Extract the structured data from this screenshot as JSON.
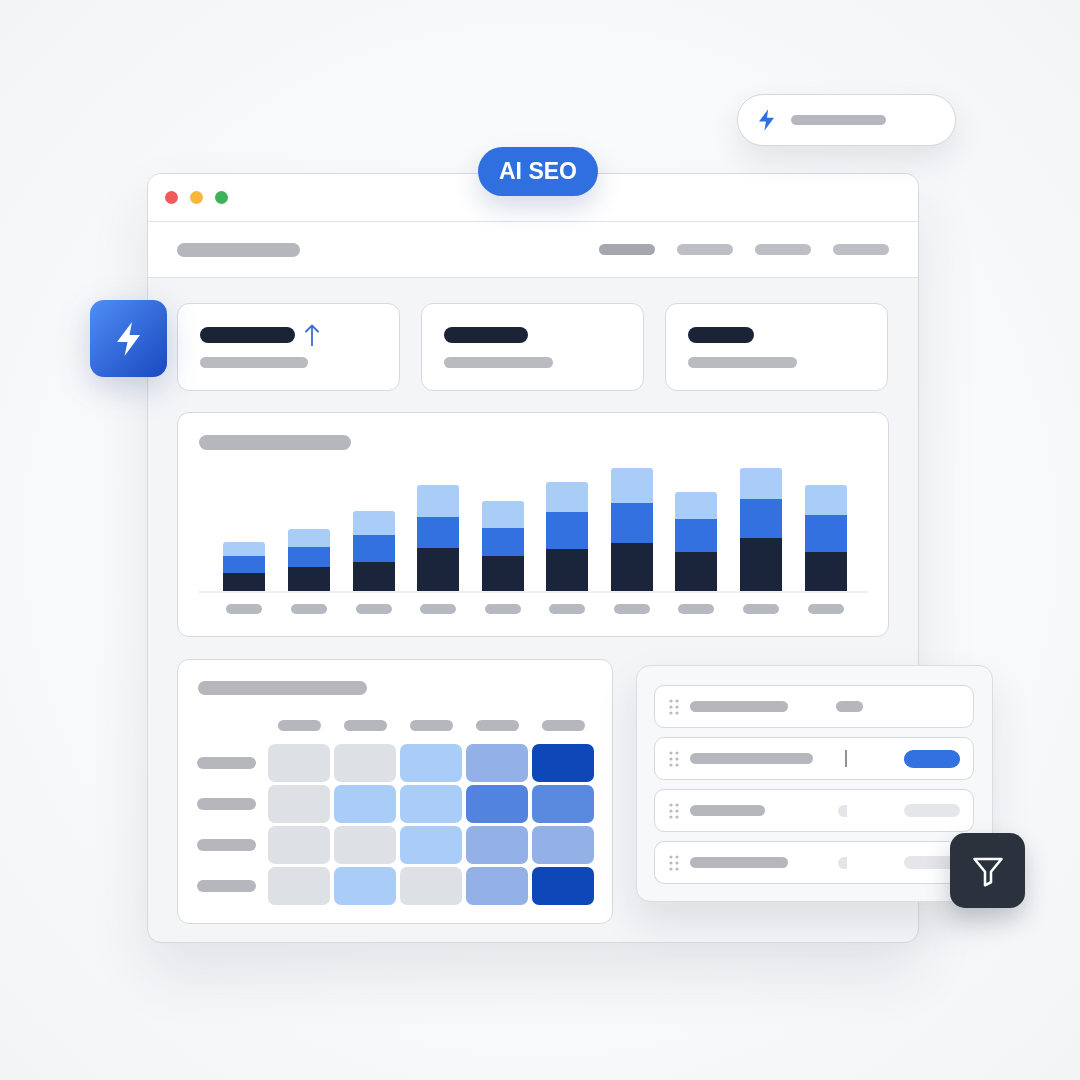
{
  "badge": {
    "label": "AI SEO"
  },
  "nav": {
    "items": [
      {
        "selected": true
      },
      {
        "selected": false
      },
      {
        "selected": false
      },
      {
        "selected": false
      }
    ]
  },
  "stat_cards": [
    {
      "trend_up": true
    },
    {
      "trend_up": false
    },
    {
      "trend_up": false
    }
  ],
  "heatmap": {
    "rows": [
      {
        "cells": [
          {
            "color": "#dde0e5"
          },
          {
            "color": "#dde0e5"
          },
          {
            "color": "#a9cdf7"
          },
          {
            "color": "#93b1e6"
          },
          {
            "color": "#0d47b8"
          }
        ]
      },
      {
        "cells": [
          {
            "color": "#dde0e5"
          },
          {
            "color": "#a9cdf7"
          },
          {
            "color": "#a9cdf7"
          },
          {
            "color": "#5283de"
          },
          {
            "color": "#5a89e0"
          }
        ]
      },
      {
        "cells": [
          {
            "color": "#dde0e5"
          },
          {
            "color": "#dde0e5"
          },
          {
            "color": "#a9cdf7"
          },
          {
            "color": "#93b1e6"
          },
          {
            "color": "#93b1e6"
          }
        ]
      },
      {
        "cells": [
          {
            "color": "#dde0e5"
          },
          {
            "color": "#a9cdf7"
          },
          {
            "color": "#dde0e5"
          },
          {
            "color": "#93b1e6"
          },
          {
            "color": "#0d47b8"
          }
        ]
      }
    ]
  },
  "list": {
    "rows": [
      {
        "kind": "tag"
      },
      {
        "kind": "active"
      },
      {
        "kind": "muted"
      },
      {
        "kind": "muted"
      }
    ]
  }
}
